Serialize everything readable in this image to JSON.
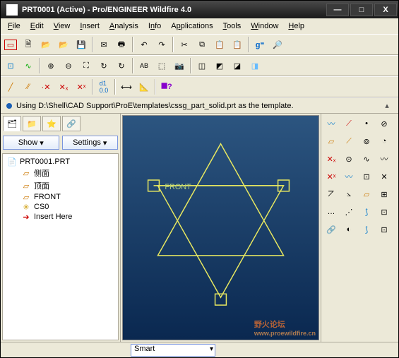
{
  "title": "PRT0001 (Active) - Pro/ENGINEER Wildfire 4.0",
  "menu": {
    "file": "File",
    "edit": "Edit",
    "view": "View",
    "insert": "Insert",
    "analysis": "Analysis",
    "info": "Info",
    "applications": "Applications",
    "tools": "Tools",
    "window": "Window",
    "help": "Help"
  },
  "message": "Using D:\\Shell\\CAD Support\\ProE\\templates\\cssg_part_solid.prt as the template.",
  "sidebar": {
    "show": "Show",
    "settings": "Settings",
    "root": "PRT0001.PRT",
    "items": [
      "侧面",
      "顶面",
      "FRONT",
      "CS0",
      "Insert Here"
    ]
  },
  "viewport": {
    "label": "FRONT"
  },
  "status": {
    "combo": "Smart"
  },
  "watermark": {
    "main": "野火论坛",
    "sub": "www.proewildfire.cn"
  },
  "icons": {
    "rect": "▭",
    "doc": "🗎",
    "open": "📂",
    "save": "💾",
    "mail": "✉",
    "print": "🖶",
    "undo": "↶",
    "redo": "↷",
    "cut": "✂",
    "copy": "⧉",
    "paste": "📋",
    "find": "🔍",
    "node": "⊡",
    "curve": "∿",
    "zoomin": "⊕",
    "zoomout": "⊖",
    "zoomfit": "⛶",
    "refresh": "↻",
    "text": "AB",
    "layers": "⬚",
    "camera": "📷",
    "wire": "◫",
    "hidden": "◩",
    "shade": "◪",
    "shadeE": "◨",
    "line": "╱",
    "dim": "⟷",
    "measure": "📐",
    "help": "?",
    "spline": "〰",
    "pt": "·✕",
    "rect2": "▱",
    "circle": "○",
    "arc": "⌒",
    "fillet": "⦢",
    "more": "…",
    "axis": "✕"
  }
}
